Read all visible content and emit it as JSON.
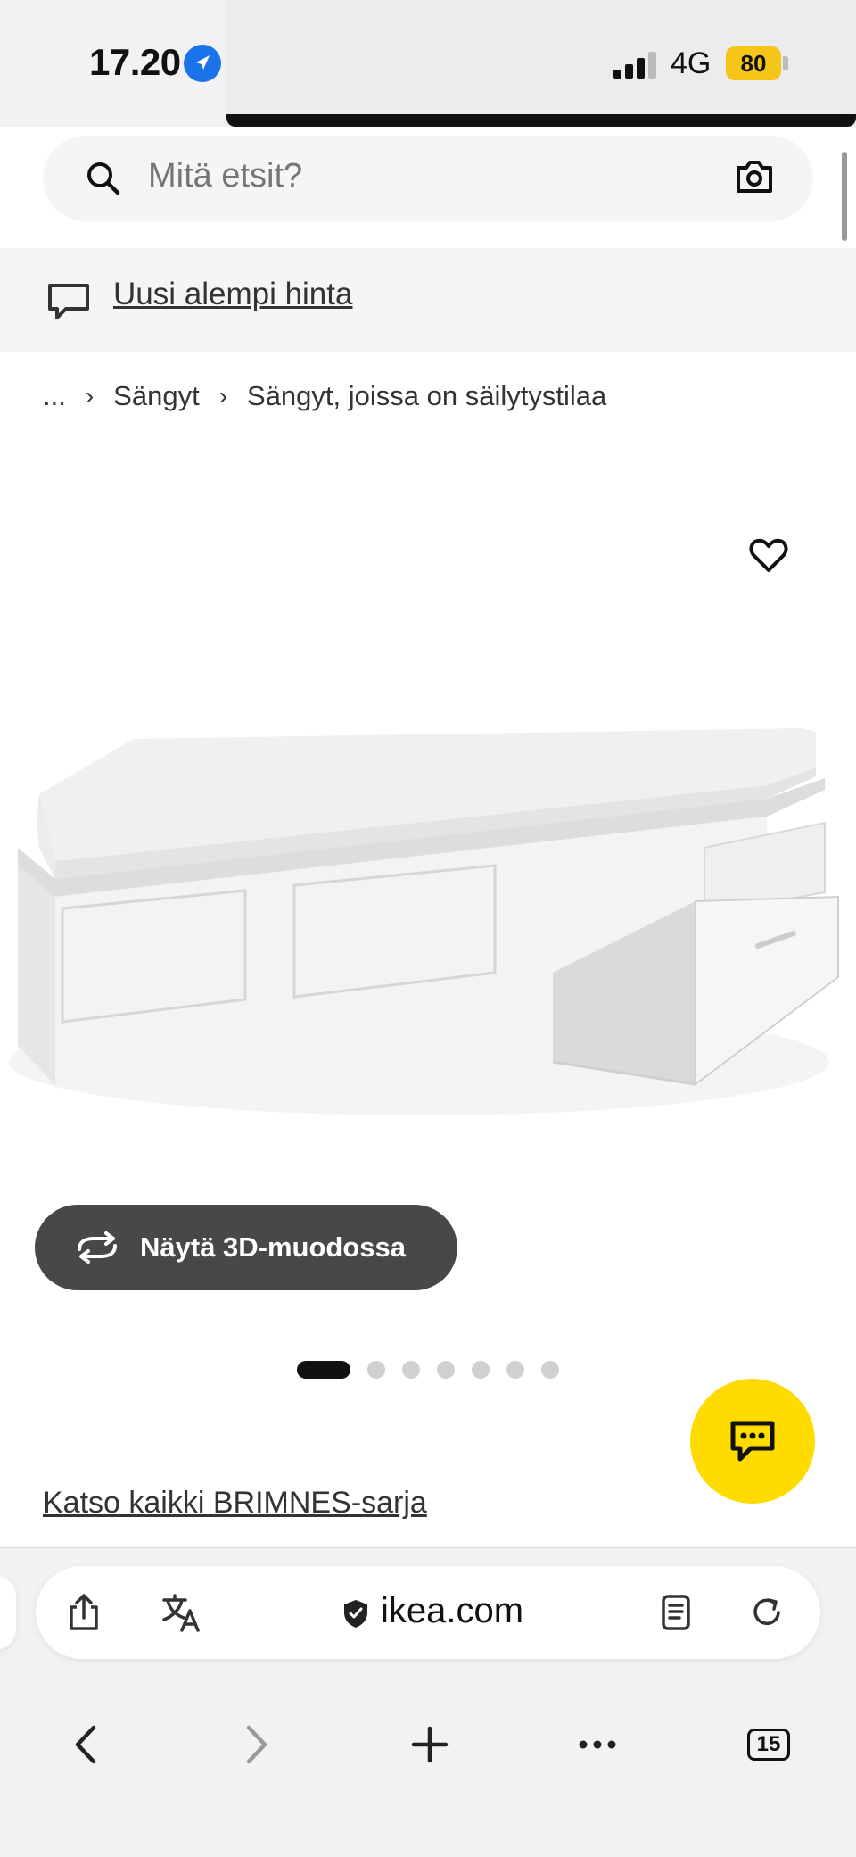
{
  "status_bar": {
    "time": "17.20",
    "network": "4G",
    "battery": "80"
  },
  "search": {
    "placeholder": "Mitä etsit?"
  },
  "price_banner": {
    "link": "Uusi alempi hinta"
  },
  "breadcrumb": {
    "items": [
      "...",
      "Sängyt",
      "Sängyt, joissa on säilytystilaa"
    ]
  },
  "product": {
    "view_3d_label": "Näytä 3D-muodossa",
    "image_count": 7,
    "active_image": 1,
    "series_link": "Katso kaikki BRIMNES-sarja"
  },
  "browser": {
    "url": "ikea.com",
    "tab_count": "15"
  },
  "colors": {
    "ikea_yellow": "#ffdb00",
    "button_dark": "#484848",
    "battery_yellow": "#f5c518",
    "location_blue": "#1a73e8"
  }
}
